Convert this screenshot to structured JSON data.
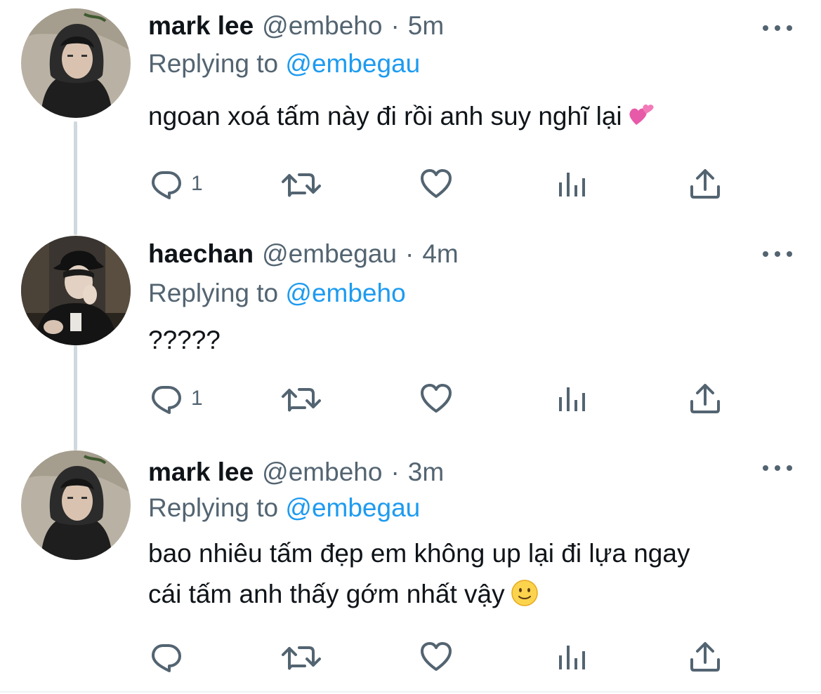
{
  "colors": {
    "text_primary": "#0f1419",
    "text_secondary": "#536471",
    "mention": "#1d9bf0",
    "connector": "#cfd9de",
    "background": "#ffffff"
  },
  "tweets": [
    {
      "name": "mark lee",
      "handle": "@embeho",
      "dot": "·",
      "time": "5m",
      "reply_prefix": "Replying to",
      "reply_to": "@embegau",
      "text_lines": [
        "ngoan xoá tấm này đi rồi anh suy nghĩ lại"
      ],
      "emoji": "two-hearts-emoji",
      "reply_count": "1",
      "icons": [
        "reply-icon",
        "retweet-icon",
        "like-icon",
        "views-icon",
        "share-icon",
        "more-icon"
      ]
    },
    {
      "name": "haechan",
      "handle": "@embegau",
      "dot": "·",
      "time": "4m",
      "reply_prefix": "Replying to",
      "reply_to": "@embeho",
      "text_lines": [
        "?????"
      ],
      "emoji": "",
      "reply_count": "1",
      "icons": [
        "reply-icon",
        "retweet-icon",
        "like-icon",
        "views-icon",
        "share-icon",
        "more-icon"
      ]
    },
    {
      "name": "mark lee",
      "handle": "@embeho",
      "dot": "·",
      "time": "3m",
      "reply_prefix": "Replying to",
      "reply_to": "@embegau",
      "text_lines": [
        "bao nhiêu tấm đẹp em không up lại đi lựa ngay",
        "cái tấm anh thấy gớm nhất vậy"
      ],
      "emoji": "slightly-smiling-face-emoji",
      "reply_count": "",
      "icons": [
        "reply-icon",
        "retweet-icon",
        "like-icon",
        "views-icon",
        "share-icon",
        "more-icon"
      ]
    }
  ]
}
